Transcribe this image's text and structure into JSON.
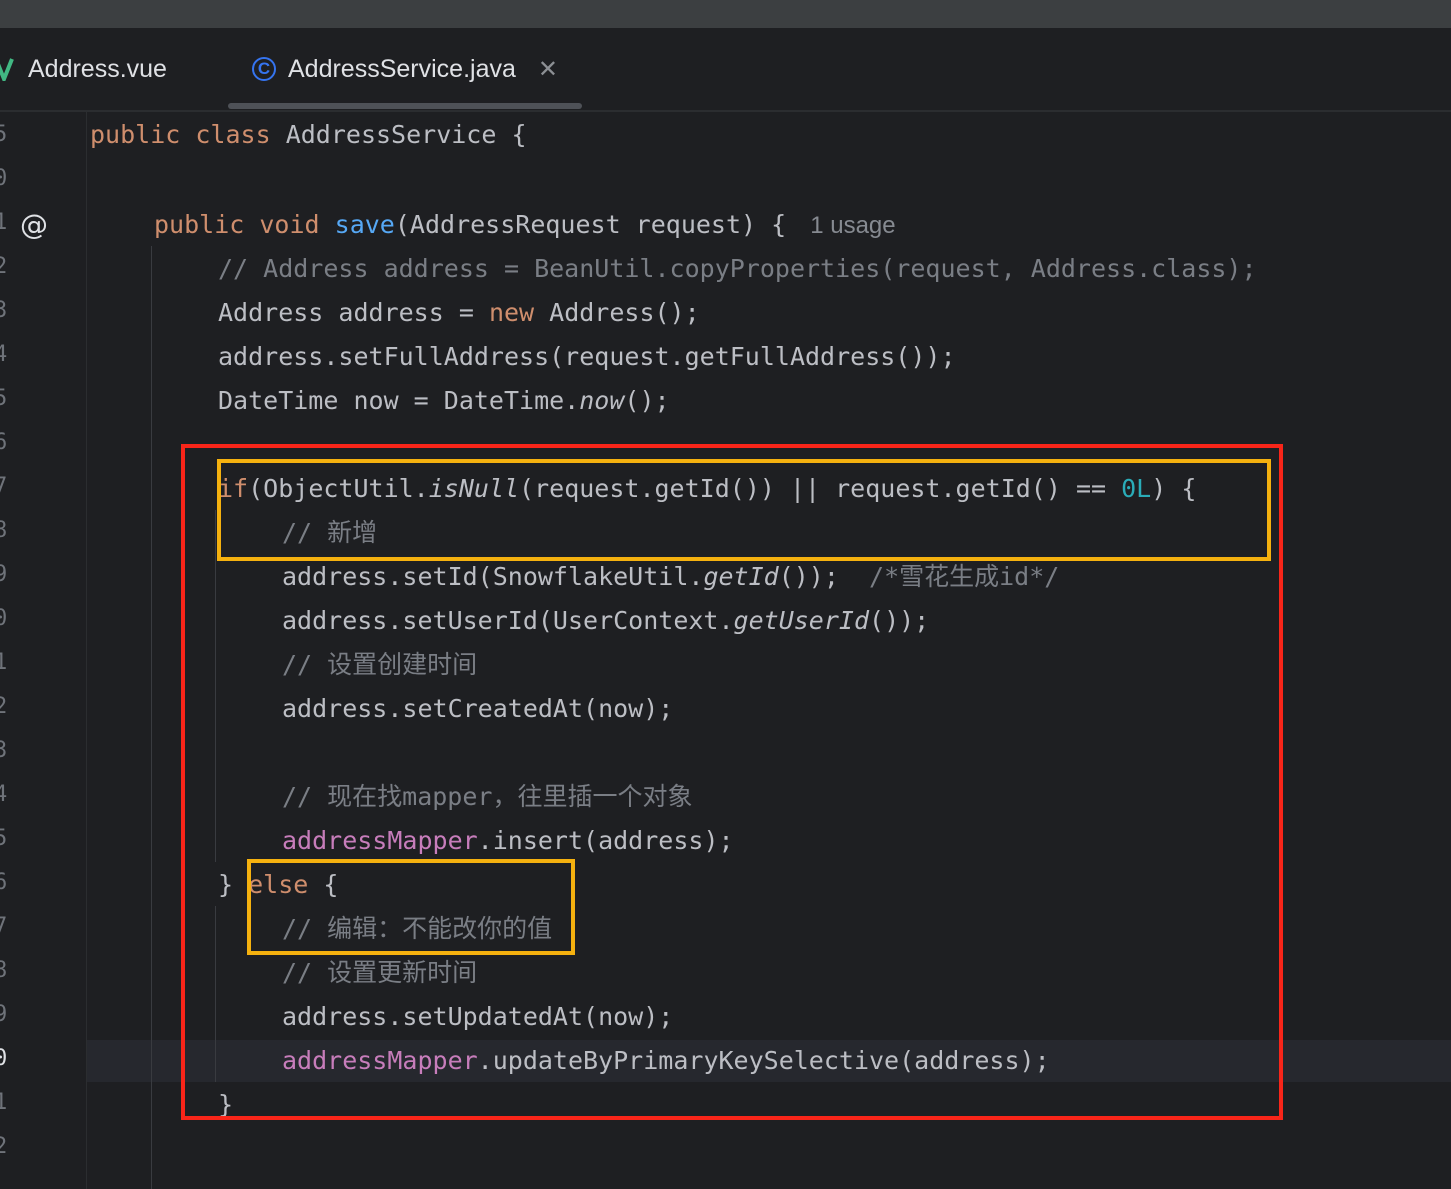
{
  "tabs": [
    {
      "label": "Address.vue",
      "icon": "vue-icon"
    },
    {
      "label": "AddressService.java",
      "icon": "java-class-icon",
      "active": true
    }
  ],
  "gutter": {
    "line_numbers": [
      "5",
      "0",
      "1",
      "2",
      "3",
      "4",
      "5",
      "6",
      "7",
      "8",
      "9",
      "0",
      "1",
      "2",
      "3",
      "4",
      "5",
      "6",
      "7",
      "8",
      "9",
      "0",
      "1",
      "2"
    ],
    "current_line": "0"
  },
  "code": {
    "l1": {
      "kw": "public class",
      "name": "AddressService {"
    },
    "l3": {
      "kw": "public void",
      "fn": "save",
      "rest": "(AddressRequest request) {",
      "usage": "1 usage"
    },
    "l4": "// Address address = BeanUtil.copyProperties(request, Address.class);",
    "l5": {
      "a": "Address address = ",
      "kw": "new",
      "b": " Address();"
    },
    "l6": "address.setFullAddress(request.getFullAddress());",
    "l7": {
      "a": "DateTime now = DateTime.",
      "it": "now",
      "b": "();"
    },
    "l9": {
      "kw": "if",
      "a": "(ObjectUtil.",
      "it": "isNull",
      "b": "(request.getId()) || request.getId() == ",
      "num": "0L",
      "c": ") {"
    },
    "l10": "// 新增",
    "l11": {
      "a": "address.setId(SnowflakeUtil.",
      "it": "getId",
      "b": "());  ",
      "cm": "/*雪花生成id*/"
    },
    "l12": {
      "a": "address.setUserId(UserContext.",
      "it": "getUserId",
      "b": "());"
    },
    "l13": "// 设置创建时间",
    "l14": "address.setCreatedAt(now);",
    "l16": "// 现在找mapper，往里插一个对象",
    "l17": {
      "field": "addressMapper",
      "b": ".insert(address);"
    },
    "l18": {
      "a": "} ",
      "kw": "else",
      "b": " {"
    },
    "l19": "// 编辑：不能改你的值",
    "l20": "// 设置更新时间",
    "l21": "address.setUpdatedAt(now);",
    "l22": {
      "field": "addressMapper",
      "b": ".updateByPrimaryKeySelective(address);"
    },
    "l23": "}"
  },
  "colors": {
    "keyword": "#cf8e6d",
    "function": "#56a8f5",
    "comment": "#7a7e85",
    "field": "#c77dbb",
    "number": "#2aacb8",
    "annotation_red": "#f82519",
    "annotation_orange": "#f5b10f"
  }
}
